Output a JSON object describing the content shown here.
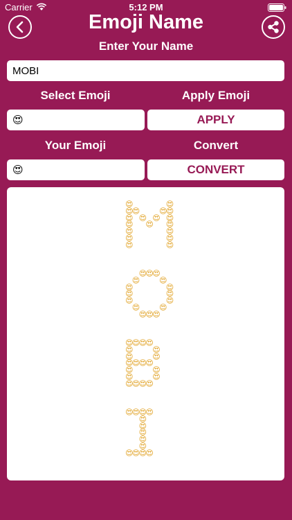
{
  "status_bar": {
    "carrier": "Carrier",
    "time": "5:12 PM"
  },
  "header": {
    "title": "Emoji Name",
    "subtitle": "Enter Your Name",
    "back_icon": "chevron-left-icon",
    "share_icon": "share-icon"
  },
  "name_input": {
    "value": "MOBI"
  },
  "labels": {
    "select_emoji": "Select Emoji",
    "apply_emoji": "Apply Emoji",
    "your_emoji": "Your Emoji",
    "convert": "Convert"
  },
  "select_emoji_field": {
    "value": "😍"
  },
  "your_emoji_field": {
    "value": "😍"
  },
  "buttons": {
    "apply": "APPLY",
    "convert": "CONVERT"
  },
  "output": {
    "emoji": "😍",
    "text": "MOBI"
  },
  "colors": {
    "background": "#971a55",
    "panel": "#ffffff",
    "button_text": "#971a55"
  }
}
